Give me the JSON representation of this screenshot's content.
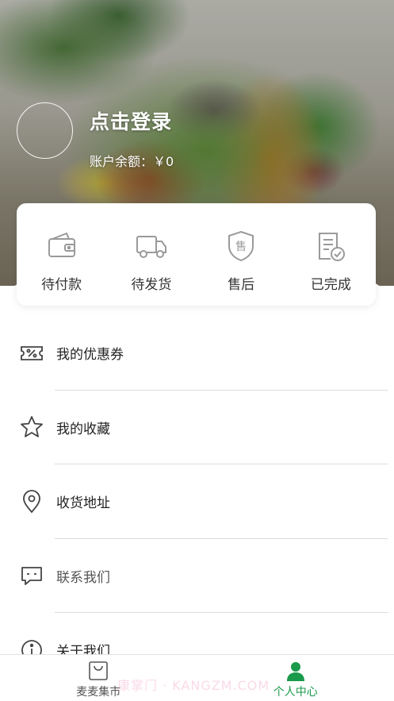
{
  "profile": {
    "login_text": "点击登录",
    "balance_label": "账户余额：￥0"
  },
  "orders": [
    {
      "label": "待付款",
      "icon": "wallet-icon"
    },
    {
      "label": "待发货",
      "icon": "truck-icon"
    },
    {
      "label": "售后",
      "icon": "after-sales-shield-icon"
    },
    {
      "label": "已完成",
      "icon": "completed-document-icon"
    }
  ],
  "menu": [
    {
      "label": "我的优惠券",
      "icon": "coupon-icon"
    },
    {
      "label": "我的收藏",
      "icon": "star-icon"
    },
    {
      "label": "收货地址",
      "icon": "location-pin-icon"
    },
    {
      "label": "联系我们",
      "icon": "chat-bubble-icon"
    },
    {
      "label": "关于我们",
      "icon": "info-icon"
    }
  ],
  "tabbar": {
    "items": [
      {
        "label": "麦麦集市",
        "icon": "shopping-bag-icon",
        "active": false
      },
      {
        "label": "个人中心",
        "icon": "user-icon",
        "active": true
      }
    ],
    "active_color": "#1a9a4b"
  },
  "watermark": "康掌门 · KANGZM.COM"
}
